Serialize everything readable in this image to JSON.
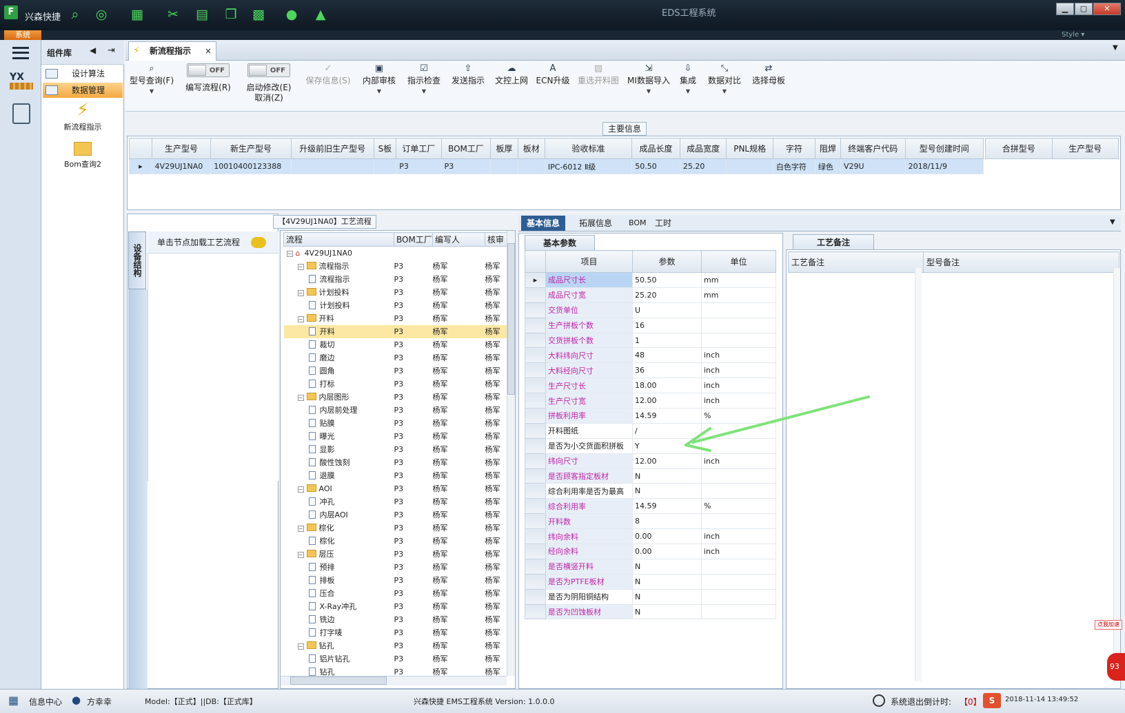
{
  "window": {
    "app_label": "兴森快捷",
    "title": "EDS工程系统",
    "btn_min": "▁",
    "btn_max": "▢",
    "btn_close": "✕"
  },
  "menu": {
    "system": "系统",
    "style": "Style ▾"
  },
  "top_icons": [
    "search-icon",
    "lifebuoy-icon",
    "grid-icon",
    "scissors-icon",
    "film-icon",
    "layers-icon",
    "apps-icon",
    "user-icon",
    "chart-icon"
  ],
  "left_nav": {
    "yx_label": "YX"
  },
  "component_nav": {
    "title": "组件库",
    "items": [
      {
        "label": "设计算法"
      },
      {
        "label": "数据管理"
      }
    ],
    "big_items": [
      {
        "label": "新流程指示"
      },
      {
        "label": "Bom查询2"
      }
    ]
  },
  "tab": {
    "label": "新流程指示"
  },
  "toolbar": {
    "query": "型号查询(F)",
    "write_flow": "编写流程(R)",
    "enable_modify": "启动修改(E)",
    "cancel": "取消(Z)",
    "toggle_off": "OFF",
    "save": "保存信息(S)",
    "internal_review": "内部审核",
    "check": "指示检查",
    "send": "发送指示",
    "upload": "文控上网",
    "ecn": "ECN升级",
    "reselect": "重选开料图",
    "mi_import": "MI数据导入",
    "integrate": "集成",
    "compare": "数据对比",
    "select_board": "选择母板"
  },
  "main_info": {
    "title": "主要信息",
    "columns": [
      "生产型号",
      "新生产型号",
      "升级前旧生产型号",
      "S板",
      "订单工厂",
      "BOM工厂",
      "板厚",
      "板材",
      "验收标准",
      "成品长度",
      "成品宽度",
      "PNL规格",
      "字符",
      "阻焊",
      "终端客户代码",
      "型号创建时间"
    ],
    "row": [
      "4V29UJ1NA0",
      "10010400123388",
      "",
      "",
      "P3",
      "P3",
      "",
      "",
      "IPC-6012 Ⅱ级",
      "50.50",
      "25.20",
      "",
      "白色字符",
      "绿色",
      "V29U",
      "2018/11/9"
    ],
    "side_columns": [
      "合拼型号",
      "生产型号"
    ]
  },
  "left_panel": {
    "vertical_tab": "设备结构",
    "load_text": "单击节点加载工艺流程"
  },
  "process_tree": {
    "title": "【4V29UJ1NA0】工艺流程",
    "columns": [
      "流程",
      "BOM工厂",
      "编写人",
      "核审"
    ],
    "rows": [
      {
        "name": "4V29UJ1NA0",
        "level": 0,
        "kind": "root",
        "bom": "",
        "writer": "",
        "reviewer": ""
      },
      {
        "name": "流程指示",
        "level": 1,
        "kind": "folder",
        "bom": "P3",
        "writer": "杨军",
        "reviewer": "杨军"
      },
      {
        "name": "流程指示",
        "level": 2,
        "kind": "doc",
        "bom": "P3",
        "writer": "杨军",
        "reviewer": "杨军"
      },
      {
        "name": "计划投料",
        "level": 1,
        "kind": "folder",
        "bom": "P3",
        "writer": "杨军",
        "reviewer": "杨军"
      },
      {
        "name": "计划投料",
        "level": 2,
        "kind": "doc",
        "bom": "P3",
        "writer": "杨军",
        "reviewer": "杨军"
      },
      {
        "name": "开料",
        "level": 1,
        "kind": "folder",
        "bom": "P3",
        "writer": "杨军",
        "reviewer": "杨军"
      },
      {
        "name": "开料",
        "level": 2,
        "kind": "doc",
        "bom": "P3",
        "writer": "杨军",
        "reviewer": "杨军",
        "hl": true
      },
      {
        "name": "裁切",
        "level": 2,
        "kind": "doc",
        "bom": "P3",
        "writer": "杨军",
        "reviewer": "杨军"
      },
      {
        "name": "磨边",
        "level": 2,
        "kind": "doc",
        "bom": "P3",
        "writer": "杨军",
        "reviewer": "杨军"
      },
      {
        "name": "圆角",
        "level": 2,
        "kind": "doc",
        "bom": "P3",
        "writer": "杨军",
        "reviewer": "杨军"
      },
      {
        "name": "打标",
        "level": 2,
        "kind": "doc",
        "bom": "P3",
        "writer": "杨军",
        "reviewer": "杨军"
      },
      {
        "name": "内层图形",
        "level": 1,
        "kind": "folder",
        "bom": "P3",
        "writer": "杨军",
        "reviewer": "杨军"
      },
      {
        "name": "内层前处理",
        "level": 2,
        "kind": "doc",
        "bom": "P3",
        "writer": "杨军",
        "reviewer": "杨军"
      },
      {
        "name": "贴膜",
        "level": 2,
        "kind": "doc",
        "bom": "P3",
        "writer": "杨军",
        "reviewer": "杨军"
      },
      {
        "name": "曝光",
        "level": 2,
        "kind": "doc",
        "bom": "P3",
        "writer": "杨军",
        "reviewer": "杨军"
      },
      {
        "name": "显影",
        "level": 2,
        "kind": "doc",
        "bom": "P3",
        "writer": "杨军",
        "reviewer": "杨军"
      },
      {
        "name": "酸性蚀刻",
        "level": 2,
        "kind": "doc",
        "bom": "P3",
        "writer": "杨军",
        "reviewer": "杨军"
      },
      {
        "name": "退膜",
        "level": 2,
        "kind": "doc",
        "bom": "P3",
        "writer": "杨军",
        "reviewer": "杨军"
      },
      {
        "name": "AOI",
        "level": 1,
        "kind": "folder",
        "bom": "P3",
        "writer": "杨军",
        "reviewer": "杨军"
      },
      {
        "name": "冲孔",
        "level": 2,
        "kind": "doc",
        "bom": "P3",
        "writer": "杨军",
        "reviewer": "杨军"
      },
      {
        "name": "内层AOI",
        "level": 2,
        "kind": "doc",
        "bom": "P3",
        "writer": "杨军",
        "reviewer": "杨军"
      },
      {
        "name": "棕化",
        "level": 1,
        "kind": "folder",
        "bom": "P3",
        "writer": "杨军",
        "reviewer": "杨军"
      },
      {
        "name": "棕化",
        "level": 2,
        "kind": "doc",
        "bom": "P3",
        "writer": "杨军",
        "reviewer": "杨军"
      },
      {
        "name": "层压",
        "level": 1,
        "kind": "folder",
        "bom": "P3",
        "writer": "杨军",
        "reviewer": "杨军"
      },
      {
        "name": "预排",
        "level": 2,
        "kind": "doc",
        "bom": "P3",
        "writer": "杨军",
        "reviewer": "杨军"
      },
      {
        "name": "排板",
        "level": 2,
        "kind": "doc",
        "bom": "P3",
        "writer": "杨军",
        "reviewer": "杨军"
      },
      {
        "name": "压合",
        "level": 2,
        "kind": "doc",
        "bom": "P3",
        "writer": "杨军",
        "reviewer": "杨军"
      },
      {
        "name": "X-Ray冲孔",
        "level": 2,
        "kind": "doc",
        "bom": "P3",
        "writer": "杨军",
        "reviewer": "杨军"
      },
      {
        "name": "铣边",
        "level": 2,
        "kind": "doc",
        "bom": "P3",
        "writer": "杨军",
        "reviewer": "杨军"
      },
      {
        "name": "打字唛",
        "level": 2,
        "kind": "doc",
        "bom": "P3",
        "writer": "杨军",
        "reviewer": "杨军"
      },
      {
        "name": "钻孔",
        "level": 1,
        "kind": "folder",
        "bom": "P3",
        "writer": "杨军",
        "reviewer": "杨军"
      },
      {
        "name": "铝片钻孔",
        "level": 2,
        "kind": "doc",
        "bom": "P3",
        "writer": "杨军",
        "reviewer": "杨军"
      },
      {
        "name": "钻孔",
        "level": 2,
        "kind": "doc",
        "bom": "P3",
        "writer": "杨军",
        "reviewer": "杨军"
      }
    ]
  },
  "subtabs": [
    "基本信息",
    "拓展信息",
    "BOM",
    "工时"
  ],
  "params": {
    "tab": "基本参数",
    "columns": [
      "项目",
      "参数",
      "单位"
    ],
    "rows": [
      {
        "item": "成品尺寸长",
        "value": "50.50",
        "unit": "mm",
        "pink": true
      },
      {
        "item": "成品尺寸宽",
        "value": "25.20",
        "unit": "mm",
        "pink": true
      },
      {
        "item": "交货单位",
        "value": "U",
        "unit": "",
        "pink": true
      },
      {
        "item": "生产拼板个数",
        "value": "16",
        "unit": "",
        "pink": true
      },
      {
        "item": "交货拼板个数",
        "value": "1",
        "unit": "",
        "pink": true
      },
      {
        "item": "大料纬向尺寸",
        "value": "48",
        "unit": "inch",
        "pink": true
      },
      {
        "item": "大料经向尺寸",
        "value": "36",
        "unit": "inch",
        "pink": true
      },
      {
        "item": "生产尺寸长",
        "value": "18.00",
        "unit": "inch",
        "pink": true
      },
      {
        "item": "生产尺寸宽",
        "value": "12.00",
        "unit": "inch",
        "pink": true
      },
      {
        "item": "拼板利用率",
        "value": "14.59",
        "unit": "%",
        "pink": true
      },
      {
        "item": "开料图纸",
        "value": "/",
        "unit": "",
        "pink": false
      },
      {
        "item": "是否为小交货面积拼板",
        "value": "Y",
        "unit": "",
        "pink": false
      },
      {
        "item": "纬向尺寸",
        "value": "12.00",
        "unit": "inch",
        "pink": true
      },
      {
        "item": "是否顾客指定板材",
        "value": "N",
        "unit": "",
        "pink": true
      },
      {
        "item": "综合利用率是否为最高",
        "value": "N",
        "unit": "",
        "pink": false
      },
      {
        "item": "综合利用率",
        "value": "14.59",
        "unit": "%",
        "pink": true
      },
      {
        "item": "开料数",
        "value": "8",
        "unit": "",
        "pink": true
      },
      {
        "item": "纬向余料",
        "value": "0.00",
        "unit": "inch",
        "pink": true
      },
      {
        "item": "经向余料",
        "value": "0.00",
        "unit": "inch",
        "pink": true
      },
      {
        "item": "是否横竖开料",
        "value": "N",
        "unit": "",
        "pink": true
      },
      {
        "item": "是否为PTFE板材",
        "value": "N",
        "unit": "",
        "pink": true
      },
      {
        "item": "是否为阴阳铜结构",
        "value": "N",
        "unit": "",
        "pink": false
      },
      {
        "item": "是否为凹蚀板材",
        "value": "N",
        "unit": "",
        "pink": true
      }
    ]
  },
  "notes": {
    "tab": "工艺备注",
    "col1": "工艺备注",
    "col2": "型号备注"
  },
  "status": {
    "info_center": "信息中心",
    "user": "方幸幸",
    "model": "Model:【正式】||DB:【正式库】",
    "system": "兴森快捷 EMS工程系统 Version: 1.0.0.0",
    "countdown_label": "系统退出倒计时:",
    "countdown_value": "【0】",
    "datetime": "2018-11-14 13:49:52",
    "badge": "93",
    "speed_label": "点我加速"
  },
  "colors": {
    "accent": "#2f5d93",
    "pink_text": "#c023a8",
    "highlight": "#fde8a3",
    "arrow": "#7fe27a"
  }
}
